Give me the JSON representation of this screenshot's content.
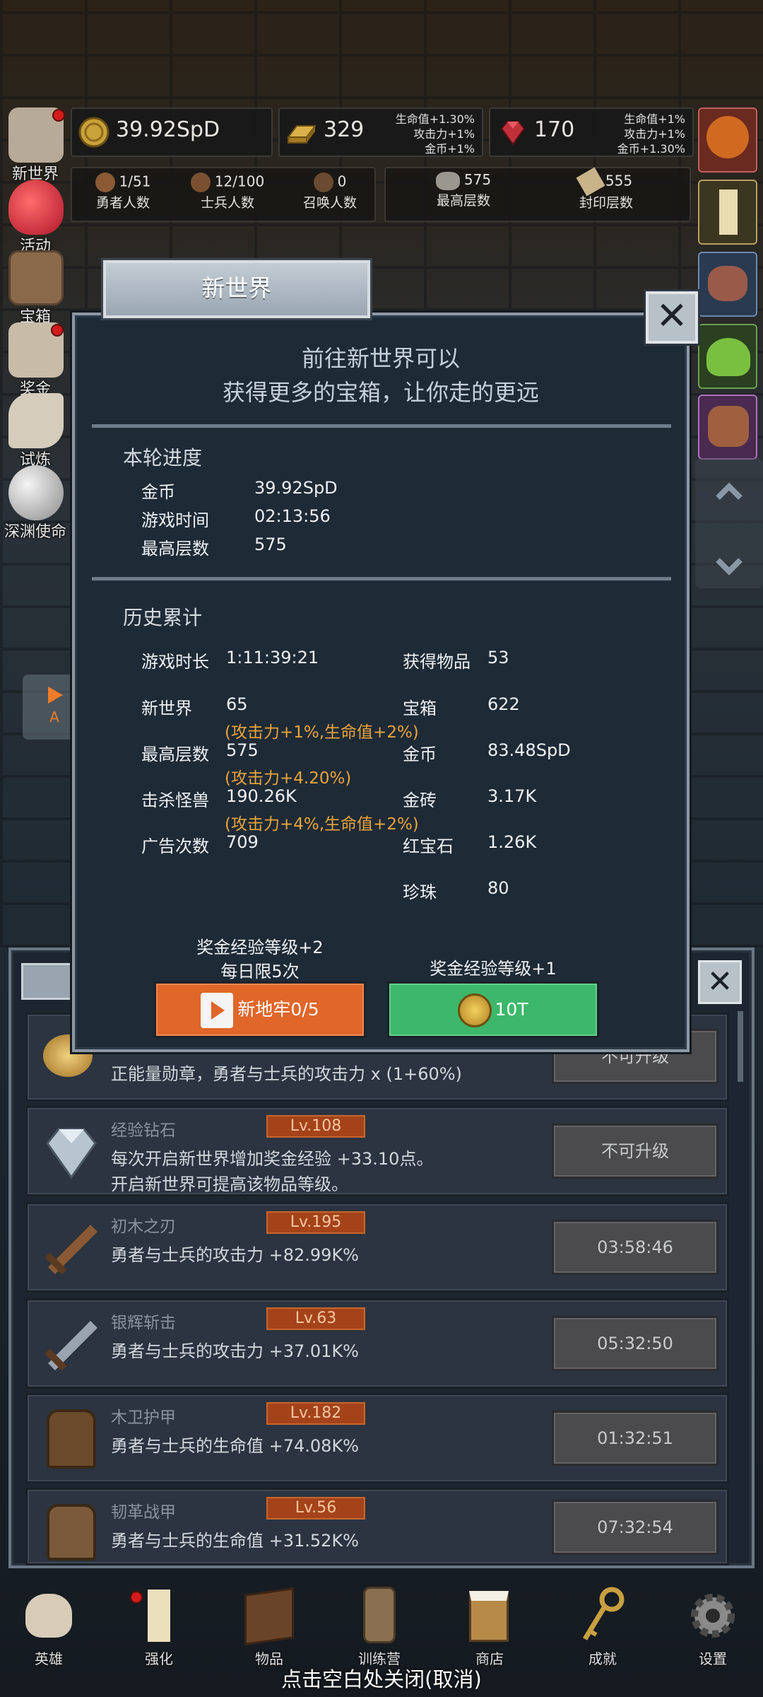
{
  "resources": {
    "gold": "39.92SpD",
    "brick": "329",
    "brick_bonus": [
      "生命值+1.30%",
      "攻击力+1%",
      "金币+1%"
    ],
    "ruby": "170",
    "ruby_bonus": [
      "生命值+1%",
      "攻击力+1%",
      "金币+1.30%"
    ]
  },
  "stats": {
    "heroes_value": "1/51",
    "heroes_label": "勇者人数",
    "soldiers_value": "12/100",
    "soldiers_label": "士兵人数",
    "summon_value": "0",
    "summon_label": "召唤人数",
    "max_floor_value": "575",
    "max_floor_label": "最高层数",
    "seal_floor_value": "555",
    "seal_floor_label": "封印层数"
  },
  "side_menu": [
    "新世界",
    "活动",
    "宝箱",
    "奖金",
    "试炼",
    "深渊使命"
  ],
  "auto_button": "A",
  "items": [
    {
      "name": "",
      "level": "",
      "desc": "正能量勋章，勇者与士兵的攻击力 x (1+60%)",
      "button": "不可升级"
    },
    {
      "name": "经验钻石",
      "level": "Lv.108",
      "desc": "每次开启新世界增加奖金经验 +33.10点。",
      "desc2": "开启新世界可提高该物品等级。",
      "button": "不可升级"
    },
    {
      "name": "初木之刃",
      "level": "Lv.195",
      "desc": "勇者与士兵的攻击力 +82.99K%",
      "button": "03:58:46"
    },
    {
      "name": "银辉斩击",
      "level": "Lv.63",
      "desc": "勇者与士兵的攻击力 +37.01K%",
      "button": "05:32:50"
    },
    {
      "name": "木卫护甲",
      "level": "Lv.182",
      "desc": "勇者与士兵的生命值 +74.08K%",
      "button": "01:32:51"
    },
    {
      "name": "韧革战甲",
      "level": "Lv.56",
      "desc": "勇者与士兵的生命值 +31.52K%",
      "button": "07:32:54"
    }
  ],
  "modal": {
    "title": "新世界",
    "headline1": "前往新世界可以",
    "headline2": "获得更多的宝箱，让你走的更远",
    "current_section": "本轮进度",
    "current": [
      {
        "label": "金币",
        "value": "39.92SpD"
      },
      {
        "label": "游戏时间",
        "value": "02:13:56"
      },
      {
        "label": "最高层数",
        "value": "575"
      }
    ],
    "history_section": "历史累计",
    "history_left": [
      {
        "label": "游戏时长",
        "value": "1:11:39:21"
      },
      {
        "label": "新世界",
        "value": "65",
        "bonus": "(攻击力+1%,生命值+2%)"
      },
      {
        "label": "最高层数",
        "value": "575",
        "bonus": "(攻击力+4.20%)"
      },
      {
        "label": "击杀怪兽",
        "value": "190.26K",
        "bonus": "(攻击力+4%,生命值+2%)"
      },
      {
        "label": "广告次数",
        "value": "709"
      }
    ],
    "history_right": [
      {
        "label": "获得物品",
        "value": "53"
      },
      {
        "label": "宝箱",
        "value": "622"
      },
      {
        "label": "金币",
        "value": "83.48SpD"
      },
      {
        "label": "金砖",
        "value": "3.17K"
      },
      {
        "label": "红宝石",
        "value": "1.26K"
      },
      {
        "label": "珍珠",
        "value": "80"
      }
    ],
    "left_note1": "奖金经验等级+2",
    "left_note2": "每日限5次",
    "right_note": "奖金经验等级+1",
    "ad_button": "新地牢0/5",
    "gold_button": "10T"
  },
  "bottom_nav": [
    "英雄",
    "强化",
    "物品",
    "训练营",
    "商店",
    "成就",
    "设置"
  ],
  "close_hint": "点击空白处关闭(取消)"
}
